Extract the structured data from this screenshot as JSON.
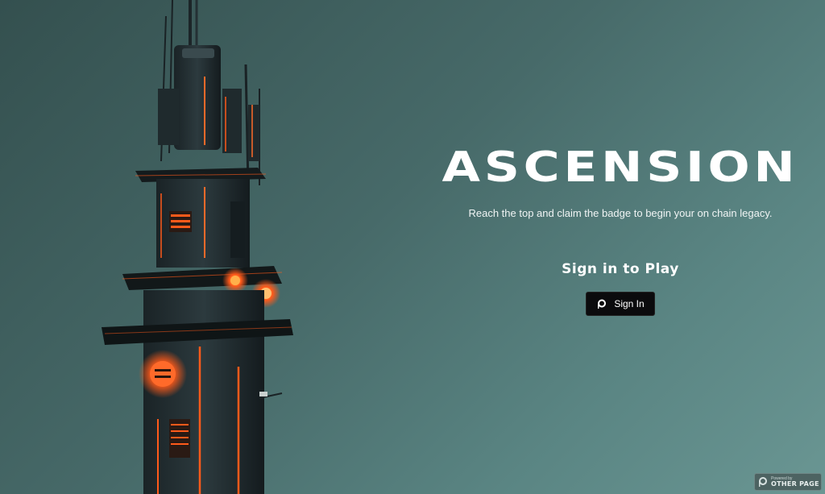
{
  "hero": {
    "title": "ASCENSION",
    "tagline": "Reach the top and claim the badge to begin your on chain legacy."
  },
  "signin": {
    "heading": "Sign in to Play",
    "button_label": "Sign In",
    "button_icon": "other-page-logo-icon"
  },
  "badge": {
    "small_text": "Powered by",
    "brand": "OTHER PAGE"
  },
  "colors": {
    "background_start": "#34504f",
    "background_end": "#6a9693",
    "accent_orange": "#ff5a1a",
    "button_bg": "#0b0b0d"
  }
}
